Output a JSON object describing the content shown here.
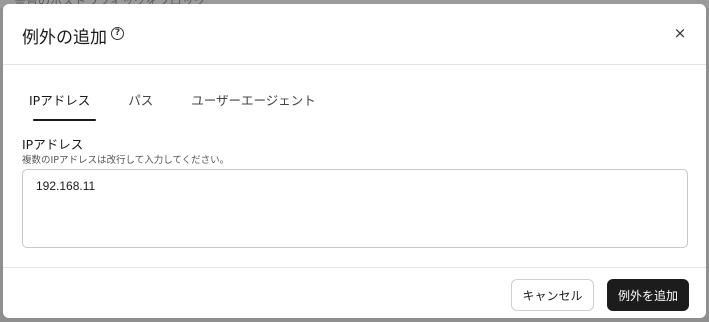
{
  "background": {
    "partial_text": "警告のホストラフィックをブロック"
  },
  "dialog": {
    "title": "例外の追加",
    "help_glyph": "?",
    "close_glyph": "×"
  },
  "tabs": [
    {
      "label": "IPアドレス",
      "active": true
    },
    {
      "label": "パス",
      "active": false
    },
    {
      "label": "ユーザーエージェント",
      "active": false
    }
  ],
  "field": {
    "label": "IPアドレス",
    "help": "複数のIPアドレスは改行して入力してください。",
    "value": "192.168.11"
  },
  "footer": {
    "cancel_label": "キャンセル",
    "submit_label": "例外を追加"
  },
  "colors": {
    "primary_button": "#1c1c1c",
    "overlay": "#8f8f8f"
  }
}
